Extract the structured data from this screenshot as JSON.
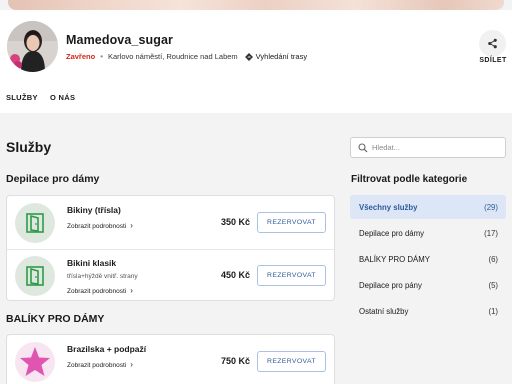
{
  "business": {
    "name": "Mamedova_sugar",
    "status": "Zavřeno",
    "address": "Karlovo náměstí, Roudnice nad Labem",
    "route_link": "Vyhledání trasy",
    "share_label": "SDÍLET"
  },
  "tabs": [
    {
      "label": "SLUŽBY"
    },
    {
      "label": "O NÁS"
    }
  ],
  "main": {
    "title": "Služby"
  },
  "categories": [
    {
      "name": "Depilace pro dámy",
      "services": [
        {
          "name": "Bikiny (třísla)",
          "description": "",
          "details_link": "Zobrazit podrobnosti",
          "price": "350 Kč",
          "book_label": "REZERVOVAT",
          "icon": "door-icon"
        },
        {
          "name": "Bikini klasik",
          "description": "třísla+hýždě vnitř. strany",
          "details_link": "Zobrazit podrobnosti",
          "price": "450 Kč",
          "book_label": "REZERVOVAT",
          "icon": "door-icon"
        }
      ]
    },
    {
      "name": "BALÍKY PRO DÁMY",
      "services": [
        {
          "name": "Brazilska + podpaží",
          "description": "",
          "details_link": "Zobrazit podrobnosti",
          "price": "750 Kč",
          "book_label": "REZERVOVAT",
          "icon": "star-icon"
        }
      ]
    }
  ],
  "sidebar": {
    "search_placeholder": "Hledat...",
    "filter_title": "Filtrovat podle kategorie",
    "filters": [
      {
        "label": "Všechny služby",
        "count": "(29)",
        "active": true
      },
      {
        "label": "Depilace pro dámy",
        "count": "(17)",
        "active": false
      },
      {
        "label": "BALÍKY PRO DÁMY",
        "count": "(6)",
        "active": false
      },
      {
        "label": "Depilace pro pány",
        "count": "(5)",
        "active": false
      },
      {
        "label": "Ostatní služby",
        "count": "(1)",
        "active": false
      }
    ]
  },
  "colors": {
    "accent": "#2f5c9a",
    "status_closed": "#d0271b",
    "active_filter_bg": "#dde6f6",
    "door_icon": "#2e9a4a",
    "star_icon": "#e055b0"
  }
}
